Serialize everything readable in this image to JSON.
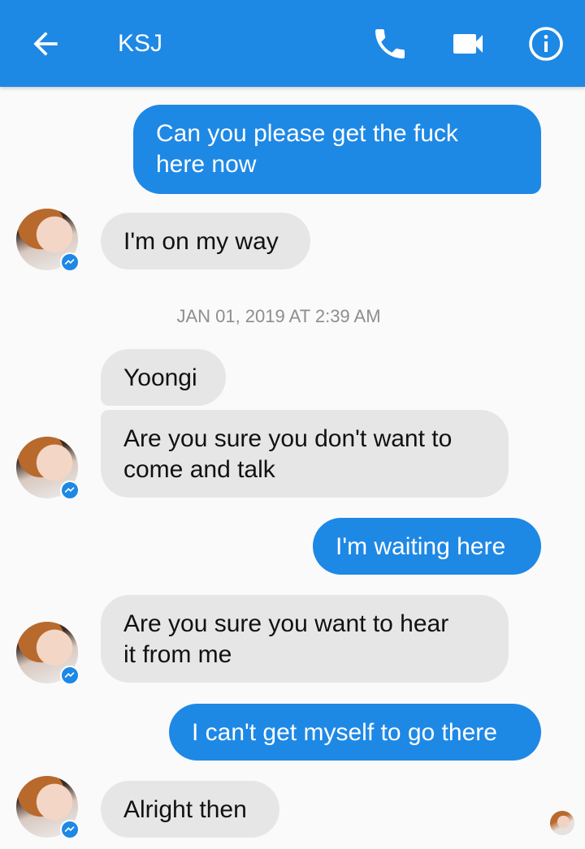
{
  "header": {
    "title": "KSJ",
    "icons": [
      "back-arrow-icon",
      "phone-icon",
      "video-camera-icon",
      "info-icon"
    ]
  },
  "messages": [
    {
      "id": 1,
      "direction": "outgoing",
      "text": "Can you please get the fuck\nhere now"
    },
    {
      "id": 2,
      "direction": "incoming",
      "text": "I'm on my way"
    },
    {
      "id": 3,
      "direction": "incoming",
      "text": "Yoongi"
    },
    {
      "id": 4,
      "direction": "incoming",
      "text": "Are you sure you don't want to\ncome and talk"
    },
    {
      "id": 5,
      "direction": "outgoing",
      "text": "I'm waiting here"
    },
    {
      "id": 6,
      "direction": "incoming",
      "text": "Are you sure you want to hear\nit from me"
    },
    {
      "id": 7,
      "direction": "outgoing",
      "text": "I can't get myself to go there"
    },
    {
      "id": 8,
      "direction": "incoming",
      "text": "Alright then"
    }
  ],
  "timestamp": "JAN 01, 2019 AT 2:39 AM",
  "colors": {
    "accent": "#1e88e5",
    "incoming_bubble": "#e6e6e6",
    "background": "#fafafa"
  }
}
